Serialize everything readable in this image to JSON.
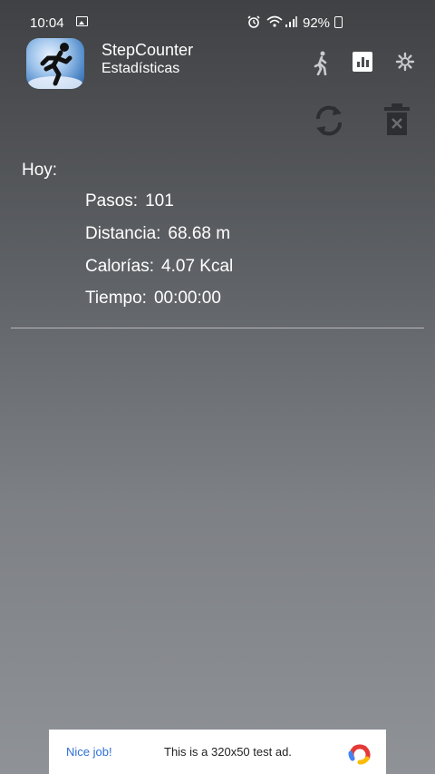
{
  "status": {
    "time": "10:04",
    "battery": "92%"
  },
  "app": {
    "title": "StepCounter",
    "subtitle": "Estadísticas"
  },
  "actions": {
    "walk_icon": "walk-icon",
    "stats_icon": "bar-chart-icon",
    "settings_icon": "gear-icon",
    "refresh_icon": "refresh-icon",
    "delete_icon": "trash-icon"
  },
  "today": {
    "label": "Hoy:",
    "steps_label": "Pasos:",
    "steps_value": "101",
    "distance_label": "Distancia:",
    "distance_value": "68.68 m",
    "calories_label": "Calorías:",
    "calories_value": "4.07 Kcal",
    "time_label": "Tiempo:",
    "time_value": "00:00:00"
  },
  "ad": {
    "nice": "Nice job!",
    "text": "This is a 320x50 test ad."
  }
}
